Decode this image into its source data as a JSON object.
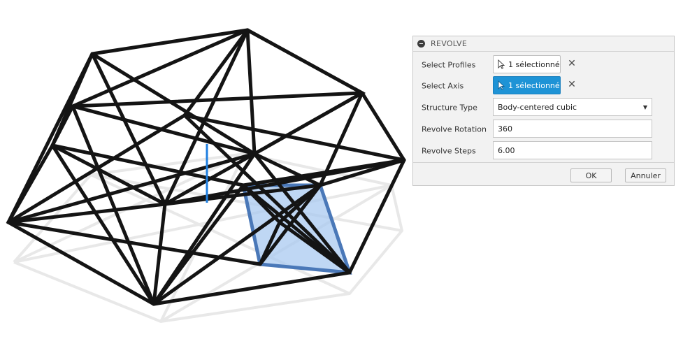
{
  "dialog": {
    "title": "REVOLVE",
    "rows": {
      "profiles": {
        "label": "Select Profiles",
        "value": "1 sélectionné"
      },
      "axis": {
        "label": "Select Axis",
        "value": "1 sélectionné"
      },
      "structure": {
        "label": "Structure Type",
        "value": "Body-centered cubic"
      },
      "rotation": {
        "label": "Revolve Rotation",
        "value": "360"
      },
      "steps": {
        "label": "Revolve Steps",
        "value": "6.00"
      }
    },
    "ok_label": "OK",
    "cancel_label": "Annuler"
  },
  "colors": {
    "accent": "#1e93d6",
    "selection_fill": "#a9c9f0",
    "lattice": "#141414",
    "axis_line": "#1f7fe0"
  },
  "icons": {
    "collapse": "minus-circle-icon",
    "cursor": "arrow-cursor-icon",
    "clear": "close-icon",
    "dropdown": "triangle-down-icon"
  }
}
